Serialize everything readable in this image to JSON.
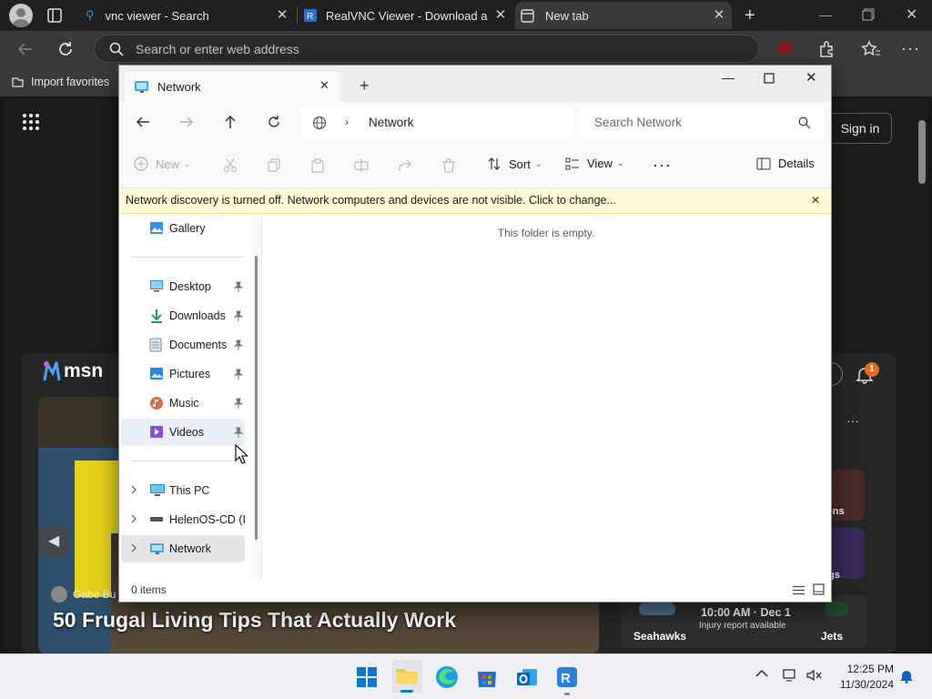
{
  "browser": {
    "tabs": [
      {
        "title": "vnc viewer - Search"
      },
      {
        "title": "RealVNC Viewer - Download and"
      },
      {
        "title": "New tab"
      }
    ],
    "address_placeholder": "Search or enter web address",
    "favorites_import": "Import favorites"
  },
  "msn": {
    "logo": "msn",
    "sign_in": "Sign in",
    "notification_count": "1",
    "author": "Gabe Bu",
    "headline": "50 Frugal Living Tips That Actually Work",
    "game_time": "10:00 AM · Dec 1",
    "game_note": "Injury report available",
    "team_home": "Seahawks",
    "team_away": "Jets",
    "side_text_1": "ons",
    "side_text_2": "gs"
  },
  "explorer": {
    "tab_title": "Network",
    "breadcrumb": "Network",
    "search_placeholder": "Search Network",
    "commands": {
      "new": "New",
      "sort": "Sort",
      "view": "View",
      "details": "Details"
    },
    "infobar": "Network discovery is turned off. Network computers and devices are not visible. Click to change...",
    "sidebar": {
      "gallery": "Gallery",
      "desktop": "Desktop",
      "downloads": "Downloads",
      "documents": "Documents",
      "pictures": "Pictures",
      "music": "Music",
      "videos": "Videos",
      "this_pc": "This PC",
      "drive": "HelenOS-CD (D:",
      "network": "Network"
    },
    "empty_message": "This folder is empty.",
    "status_items": "0 items"
  },
  "taskbar": {
    "time": "12:25 PM",
    "date": "11/30/2024"
  },
  "colors": {
    "accent": "#0067c0",
    "info_bar": "#fffbd6",
    "selected_item": "#e5e5e5",
    "taskbar": "#eef0f3"
  }
}
